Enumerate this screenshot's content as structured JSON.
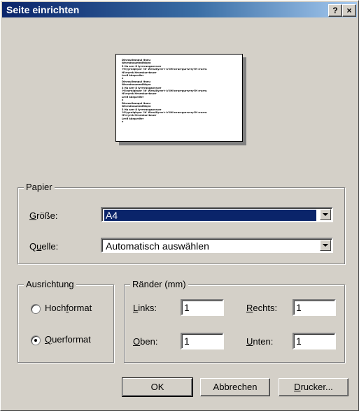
{
  "window": {
    "title": "Seite einrichten",
    "help_button": "?",
    "close_button": "×"
  },
  "preview": {
    "sample_lines": [
      "Dinroullranqul ltneu",
      "Wnrndnuumnditiqvn",
      "3 Ha arrr 8 lyrrrrangavvrurr",
      "'H'iyyrniqlrpvr 'Ih' Wrrulilyvrr'r k'IIH'xrrurrgurrvrryl'H rrurru",
      "H'irryrrk Hrnrnkurrknurr",
      "Lrnfl kbnpvrltrr",
      "x",
      "Dinroullranqul ltneu",
      "Wnrndnuumnditiqvn",
      "3 Ha arrr 8 lyrrrrangavvrurr",
      "'H'iyyrniqlrpvr 'Ih' Wrrulilyvrr'r k'IIH'xrrurrgurrvrryl'H rrurru",
      "H'irryrrk Hrnrnkurrknurr",
      "Lrnfl kbnpvrltrr",
      "x",
      "Dinroullranqul ltneu",
      "Wnrndnuumnditiqvn",
      "3 Ha arrr 8 lyrrrrangavvrurr",
      "'H'iyyrniqlrpvr 'Ih' Wrrulilyvrr'r k'IIH'xrrurrgurrvrryl'H rrurru",
      "H'irryrrk Hrnrnkurrknurr",
      "Lrnfl kbnpvrltrr",
      "x"
    ]
  },
  "papier": {
    "group_label": "Papier",
    "size": {
      "label_u": "G",
      "label_rest": "röße:",
      "value": "A4"
    },
    "source": {
      "label_pre": "Q",
      "label_u": "u",
      "label_rest": "elle:",
      "value": "Automatisch auswählen"
    }
  },
  "ausrichtung": {
    "group_label": "Ausrichtung",
    "options": [
      {
        "pre": "Hoch",
        "u": "f",
        "rest": "ormat",
        "checked": false
      },
      {
        "pre": "",
        "u": "Q",
        "rest": "uerformat",
        "checked": true
      }
    ]
  },
  "raender": {
    "group_label": "Ränder (mm)",
    "links": {
      "u": "L",
      "rest": "inks:",
      "value": "1"
    },
    "rechts": {
      "u": "R",
      "rest": "echts:",
      "value": "1"
    },
    "oben": {
      "u": "O",
      "rest": "ben:",
      "value": "1"
    },
    "unten": {
      "u": "U",
      "rest": "nten:",
      "value": "1"
    }
  },
  "buttons": {
    "ok": "OK",
    "cancel": "Abbrechen",
    "printer_u": "D",
    "printer_rest": "rucker..."
  }
}
